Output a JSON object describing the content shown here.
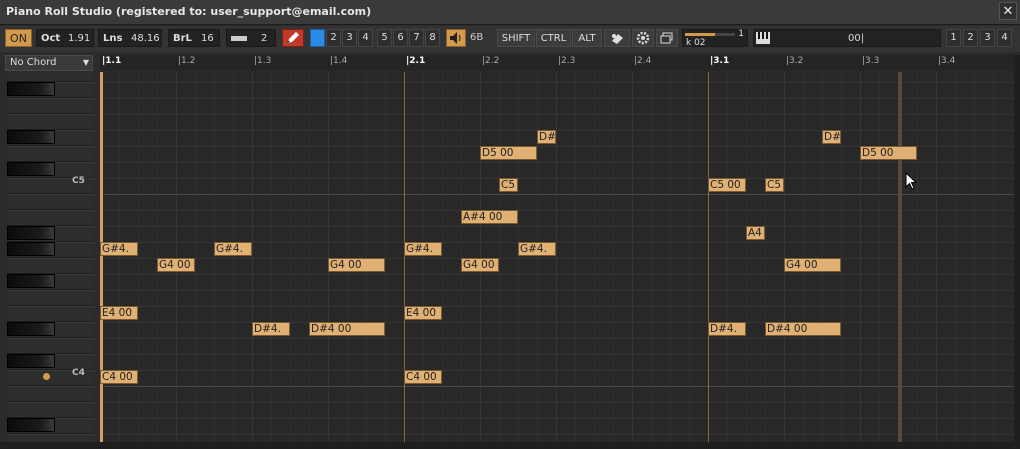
{
  "window": {
    "title": "Piano Roll Studio  (registered to: user_support@email.com)",
    "close": "✕"
  },
  "toolbar": {
    "on": "ON",
    "oct_label": "Oct",
    "oct_value": "1.91",
    "lns_label": "Lns",
    "lns_value": "48.16",
    "brl_label": "BrL",
    "brl_value": "16",
    "step_value": "2",
    "channels": [
      "2",
      "3",
      "4",
      "5",
      "6",
      "7",
      "8"
    ],
    "volume_value": "6B",
    "shift": "SHIFT",
    "ctrl": "CTRL",
    "alt": "ALT",
    "slider_label": "k 02",
    "slider_value": "1",
    "slider_level": 0.6,
    "midi_value": "00|",
    "views": [
      "1",
      "2",
      "3",
      "4"
    ]
  },
  "chord": {
    "selected": "No Chord"
  },
  "ruler": {
    "labels": [
      "1.1",
      "1.2",
      "1.3",
      "1.4",
      "2.1",
      "2.2",
      "2.3",
      "2.4",
      "3.1",
      "3.2",
      "3.3",
      "3.4"
    ]
  },
  "keyboard": {
    "labels": [
      "C5",
      "C4"
    ]
  },
  "notes": [
    {
      "text": "D#",
      "beat": 5.75,
      "len": 0.25,
      "pitch": "D#5"
    },
    {
      "text": "D#",
      "beat": 9.5,
      "len": 0.25,
      "pitch": "D#5"
    },
    {
      "text": "D5 00",
      "beat": 5.0,
      "len": 0.75,
      "pitch": "D5"
    },
    {
      "text": "D5 00",
      "beat": 10.0,
      "len": 0.75,
      "pitch": "D5"
    },
    {
      "text": "C5",
      "beat": 5.25,
      "len": 0.25,
      "pitch": "C5"
    },
    {
      "text": "C5 00",
      "beat": 8.0,
      "len": 0.5,
      "pitch": "C5"
    },
    {
      "text": "C5",
      "beat": 8.75,
      "len": 0.25,
      "pitch": "C5"
    },
    {
      "text": "A#4 00",
      "beat": 4.75,
      "len": 0.75,
      "pitch": "A#4"
    },
    {
      "text": "A4",
      "beat": 8.5,
      "len": 0.25,
      "pitch": "A4"
    },
    {
      "text": "G#4.",
      "beat": 0.0,
      "len": 0.5,
      "pitch": "G#4"
    },
    {
      "text": "G#4.",
      "beat": 1.5,
      "len": 0.5,
      "pitch": "G#4"
    },
    {
      "text": "G#4.",
      "beat": 4.0,
      "len": 0.5,
      "pitch": "G#4"
    },
    {
      "text": "G#4.",
      "beat": 5.5,
      "len": 0.5,
      "pitch": "G#4"
    },
    {
      "text": "G4 00",
      "beat": 0.75,
      "len": 0.5,
      "pitch": "G4"
    },
    {
      "text": "G4 00",
      "beat": 3.0,
      "len": 0.75,
      "pitch": "G4"
    },
    {
      "text": "G4 00",
      "beat": 4.75,
      "len": 0.5,
      "pitch": "G4"
    },
    {
      "text": "G4 00",
      "beat": 9.0,
      "len": 0.75,
      "pitch": "G4"
    },
    {
      "text": "E4 00",
      "beat": 0.0,
      "len": 0.5,
      "pitch": "E4"
    },
    {
      "text": "E4 00",
      "beat": 4.0,
      "len": 0.5,
      "pitch": "E4"
    },
    {
      "text": "D#4.",
      "beat": 2.0,
      "len": 0.5,
      "pitch": "D#4"
    },
    {
      "text": "D#4 00",
      "beat": 2.75,
      "len": 1.0,
      "pitch": "D#4"
    },
    {
      "text": "D#4.",
      "beat": 8.0,
      "len": 0.5,
      "pitch": "D#4"
    },
    {
      "text": "D#4 00",
      "beat": 8.75,
      "len": 1.0,
      "pitch": "D#4"
    },
    {
      "text": "C4 00",
      "beat": 0.0,
      "len": 0.5,
      "pitch": "C4"
    },
    {
      "text": "C4 00",
      "beat": 4.0,
      "len": 0.5,
      "pitch": "C4"
    }
  ],
  "colors": {
    "note": "#e0b074",
    "accent": "#d4a060",
    "on": "#d49a4c",
    "pencil": "#c0392b",
    "blue": "#2b8ae6"
  }
}
